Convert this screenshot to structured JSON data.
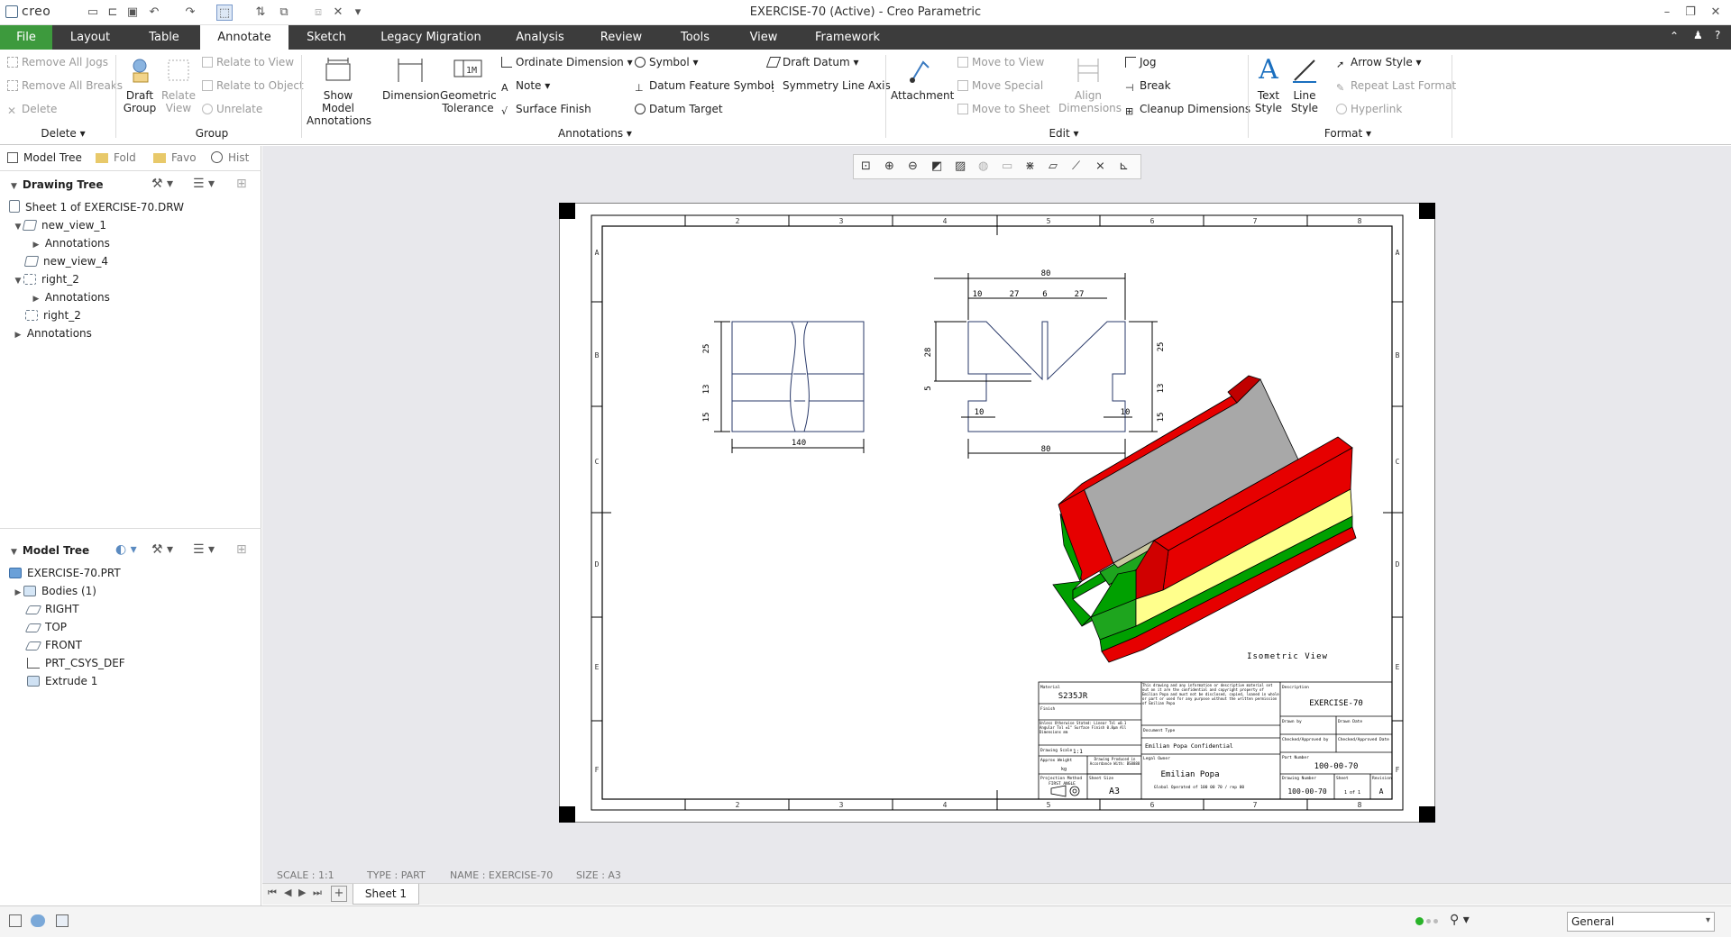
{
  "window": {
    "title": "EXERCISE-70 (Active) - Creo Parametric",
    "app_logo": "creo"
  },
  "tabs": [
    {
      "label": "File"
    },
    {
      "label": "Layout"
    },
    {
      "label": "Table"
    },
    {
      "label": "Annotate"
    },
    {
      "label": "Sketch"
    },
    {
      "label": "Legacy Migration"
    },
    {
      "label": "Analysis"
    },
    {
      "label": "Review"
    },
    {
      "label": "Tools"
    },
    {
      "label": "View"
    },
    {
      "label": "Framework"
    }
  ],
  "ribbon": {
    "delete_group": {
      "items": [
        "Remove All Jogs",
        "Remove All Breaks",
        "Delete"
      ],
      "label": "Delete"
    },
    "group_group": {
      "draft_group": "Draft Group",
      "relate_view": "Relate View",
      "items": [
        "Relate to View",
        "Relate to Object",
        "Unrelate"
      ],
      "label": "Group"
    },
    "annotations_group": {
      "show_model": "Show Model Annotations",
      "dimension": "Dimension",
      "geometric_tolerance": "Geometric Tolerance",
      "col1": [
        "Ordinate Dimension",
        "Note",
        "Surface Finish"
      ],
      "col2": [
        "Symbol",
        "Datum Feature Symbol",
        "Datum Target"
      ],
      "col3": [
        "Draft Datum",
        "Symmetry Line Axis"
      ],
      "label": "Annotations"
    },
    "edit_group": {
      "attachment": "Attachment",
      "moves": [
        "Move to View",
        "Move Special",
        "Move to Sheet"
      ],
      "align": "Align Dimensions",
      "right": [
        "Jog",
        "Break",
        "Cleanup Dimensions"
      ],
      "label": "Edit"
    },
    "format_group": {
      "text_style": "Text Style",
      "line_style": "Line Style",
      "items": [
        "Arrow Style",
        "Repeat Last Format",
        "Hyperlink"
      ],
      "label": "Format"
    }
  },
  "panel_tabs": [
    "Model Tree",
    "Fold",
    "Favo",
    "Hist"
  ],
  "drawing_tree": {
    "title": "Drawing Tree",
    "rows": [
      {
        "label": "Sheet 1 of EXERCISE-70.DRW"
      },
      {
        "label": "new_view_1"
      },
      {
        "label": "Annotations"
      },
      {
        "label": "new_view_4"
      },
      {
        "label": "right_2"
      },
      {
        "label": "Annotations"
      },
      {
        "label": "right_2"
      },
      {
        "label": "Annotations"
      }
    ]
  },
  "model_tree": {
    "title": "Model Tree",
    "rows": [
      {
        "label": "EXERCISE-70.PRT"
      },
      {
        "label": "Bodies (1)"
      },
      {
        "label": "RIGHT"
      },
      {
        "label": "TOP"
      },
      {
        "label": "FRONT"
      },
      {
        "label": "PRT_CSYS_DEF"
      },
      {
        "label": "Extrude 1"
      }
    ]
  },
  "drawing": {
    "zone_numbers": [
      "2",
      "3",
      "4",
      "5",
      "6",
      "7",
      "8"
    ],
    "zone_letters": [
      "A",
      "B",
      "C",
      "D",
      "E",
      "F"
    ],
    "front_dims": {
      "overall": "80",
      "d10a": "10",
      "d27a": "27",
      "d6": "6",
      "d27b": "27",
      "d28": "28",
      "d25": "25",
      "d13": "13",
      "d15": "15",
      "d5": "5",
      "d10b": "10",
      "d10c": "10",
      "bottom": "80"
    },
    "side_dims": {
      "width": "140",
      "d25": "25",
      "d13": "13",
      "d15": "15"
    },
    "iso_label": "Isometric View",
    "title_block": {
      "material_label": "Material",
      "material": "S235JR",
      "finish_label": "Finish",
      "notes": "Unless Otherwise Stated: Linear Tol ±0.1 Angular Tol ±1° Surface Finish 0.8μm All Dimensions mm",
      "scale_label": "Drawing Scale",
      "scale": "1:1",
      "weight_label": "Approx Weight",
      "weight": "kg",
      "std": "Drawing Produced in Accordance With: BS8888",
      "projection_label": "Projection Method",
      "projection": "FIRST ANGLE",
      "sheet_size_label": "Sheet Size",
      "sheet_size": "A3",
      "confidential": "This drawing and any information or descriptive material set out on it are the confidential and copyright property of Emilian Popa and must not be disclosed, copied, loaned in whole or part or used for any purpose without the written permission of Emilian Popa",
      "doc_type_label": "Document Type",
      "doc_type": "Emilian Popa Confidential",
      "legal_owner_label": "Legal Owner",
      "legal_owner": "Emilian Popa",
      "legal_sub": "Global Operated of 100 00 70 / rep 00",
      "description_label": "Description",
      "description": "EXERCISE-70",
      "drawn_by": "Drawn by",
      "drawn_date": "Drawn Date",
      "checked": "Checked/Approved by",
      "checked_date": "Checked/Approved Date",
      "part_number_label": "Part Number",
      "part_number": "100-00-70",
      "drawing_number_label": "Drawing Number",
      "drawing_number": "100-00-70",
      "sheet_label": "Sheet",
      "sheet": "1 of 1",
      "revision_label": "Revision",
      "revision": "A"
    }
  },
  "status": {
    "scale": "SCALE : 1:1",
    "type": "TYPE : PART",
    "name": "NAME : EXERCISE-70",
    "size": "SIZE : A3"
  },
  "sheet_tab": "Sheet 1",
  "filter": {
    "value": "General"
  },
  "colors": {
    "tabbar": "#3c3c3c",
    "file_tab": "#3d9a3d",
    "canvas": "#e8e8ec",
    "iso_red": "#e60000",
    "iso_gray": "#a8a8a8",
    "iso_green": "#1ea51e",
    "iso_yellow": "#ffff8c"
  }
}
